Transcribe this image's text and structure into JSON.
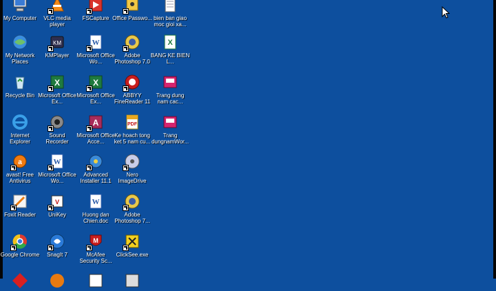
{
  "desktop": {
    "background_color": "#0d4f9e",
    "icons": [
      {
        "label": "My Computer",
        "icon": "my-computer-icon",
        "shortcut": false
      },
      {
        "label": "VLC media player",
        "icon": "vlc-icon",
        "shortcut": true
      },
      {
        "label": "FSCapture",
        "icon": "fscapture-icon",
        "shortcut": true
      },
      {
        "label": "Office Passwo...",
        "icon": "office-password-icon",
        "shortcut": true
      },
      {
        "label": "bien ban giao moc gioi xa...",
        "icon": "document-icon",
        "shortcut": false
      },
      {
        "label": "My Network Places",
        "icon": "network-places-icon",
        "shortcut": false
      },
      {
        "label": "KMPlayer",
        "icon": "kmplayer-icon",
        "shortcut": true
      },
      {
        "label": "Microsoft Office Wo...",
        "icon": "word-icon",
        "shortcut": true
      },
      {
        "label": "Adobe Photoshop 7.0",
        "icon": "photoshop-icon",
        "shortcut": true
      },
      {
        "label": "BANG KE BIEN L...",
        "icon": "excel-file-icon",
        "shortcut": false
      },
      {
        "label": "Recycle Bin",
        "icon": "recycle-bin-icon",
        "shortcut": false
      },
      {
        "label": "Microsoft Office Ex...",
        "icon": "excel-icon",
        "shortcut": true
      },
      {
        "label": "Microsoft Office Ex...",
        "icon": "excel-icon",
        "shortcut": true
      },
      {
        "label": "ABBYY FineReader 11",
        "icon": "abbyy-icon",
        "shortcut": true
      },
      {
        "label": "Trang dung nam cac...",
        "icon": "wmv-icon",
        "shortcut": false
      },
      {
        "label": "Internet Explorer",
        "icon": "internet-explorer-icon",
        "shortcut": false
      },
      {
        "label": "Sound Recorder",
        "icon": "sound-recorder-icon",
        "shortcut": true
      },
      {
        "label": "Microsoft Office Acce...",
        "icon": "access-icon",
        "shortcut": true
      },
      {
        "label": "Ke hoach tong ket 5 nam cu...",
        "icon": "pdf-icon",
        "shortcut": false
      },
      {
        "label": "Trang dungnamWor...",
        "icon": "wmv-icon",
        "shortcut": false
      },
      {
        "label": "avast! Free Antivirus",
        "icon": "avast-icon",
        "shortcut": true
      },
      {
        "label": "Microsoft Office Wo...",
        "icon": "word-icon",
        "shortcut": true
      },
      {
        "label": "Advanced Installer 11.1",
        "icon": "advanced-installer-icon",
        "shortcut": true
      },
      {
        "label": "Nero ImageDrive",
        "icon": "nero-icon",
        "shortcut": true
      },
      {
        "label": "Foxit Reader",
        "icon": "foxit-reader-icon",
        "shortcut": true
      },
      {
        "label": "UniKey",
        "icon": "unikey-icon",
        "shortcut": true
      },
      {
        "label": "Huong dan Chien.doc",
        "icon": "word-document-icon",
        "shortcut": false
      },
      {
        "label": "Adobe Photoshop 7...",
        "icon": "photoshop-icon",
        "shortcut": true
      },
      {
        "label": "Google Chrome",
        "icon": "chrome-icon",
        "shortcut": true
      },
      {
        "label": "SnagIt 7",
        "icon": "snagit-icon",
        "shortcut": true
      },
      {
        "label": "McAfee Security Sc...",
        "icon": "mcafee-icon",
        "shortcut": true
      },
      {
        "label": "ClickSee.exe",
        "icon": "clicksee-icon",
        "shortcut": true
      }
    ]
  }
}
